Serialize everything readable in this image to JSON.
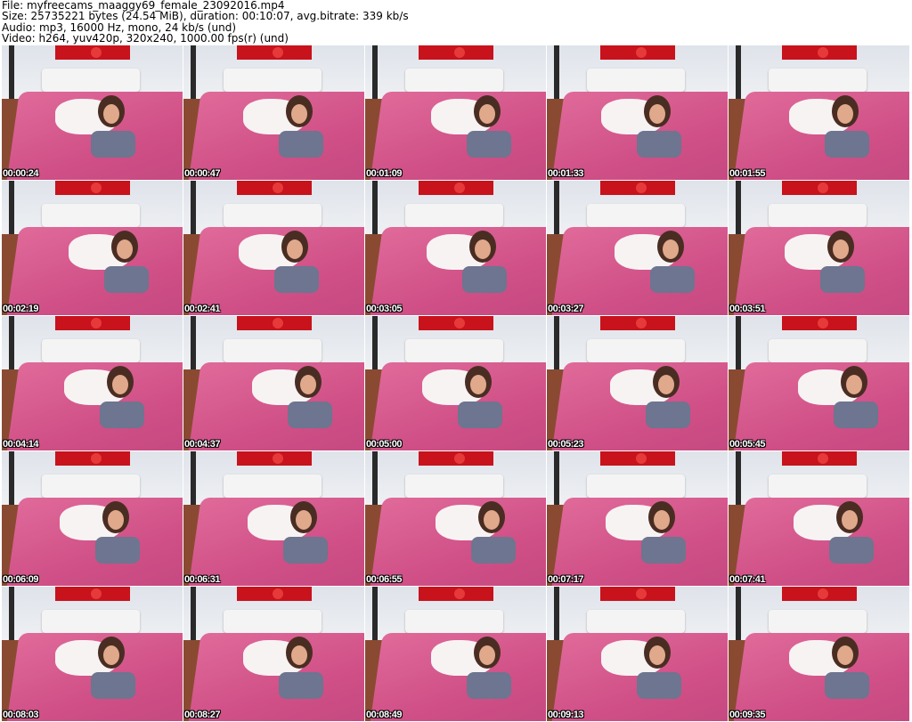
{
  "header": {
    "file": "File: myfreecams_maaggy69_female_23092016.mp4",
    "size": "Size: 25735221 bytes (24.54 MiB), duration: 00:10:07, avg.bitrate: 339 kb/s",
    "audio": "Audio: mp3, 16000 Hz, mono, 24 kb/s (und)",
    "video": "Video: h264, yuv420p, 320x240, 1000.00 fps(r) (und)"
  },
  "thumbnails": [
    "00:00:24",
    "00:00:47",
    "00:01:09",
    "00:01:33",
    "00:01:55",
    "00:02:19",
    "00:02:41",
    "00:03:05",
    "00:03:27",
    "00:03:51",
    "00:04:14",
    "00:04:37",
    "00:05:00",
    "00:05:23",
    "00:05:45",
    "00:06:09",
    "00:06:31",
    "00:06:55",
    "00:07:17",
    "00:07:41",
    "00:08:03",
    "00:08:27",
    "00:08:49",
    "00:09:13",
    "00:09:35"
  ]
}
